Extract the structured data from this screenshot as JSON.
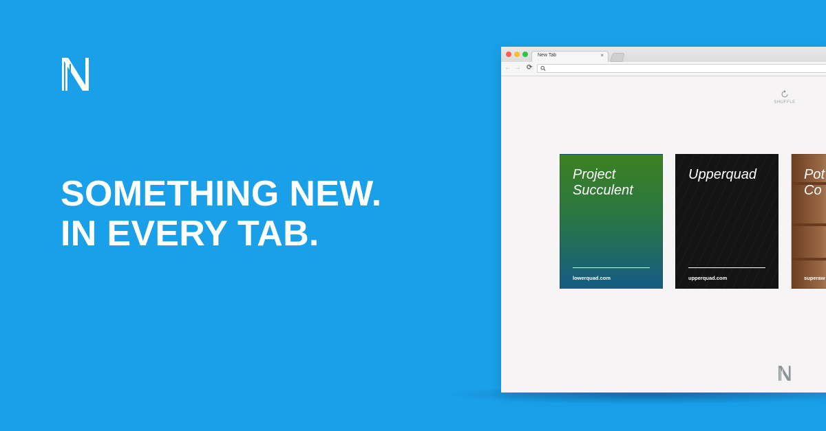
{
  "headline": {
    "line1": "SOMETHING NEW.",
    "line2": "IN EVERY TAB."
  },
  "colors": {
    "background": "#19a0e8",
    "browser_page": "#f6f4f4",
    "text_on_blue": "#ffffff"
  },
  "browser": {
    "tab_title": "New Tab",
    "tab_close": "×",
    "nav": {
      "back": "←",
      "forward": "→",
      "reload": "⟳"
    }
  },
  "shuffle": {
    "label": "SHUFFLE",
    "icon": "refresh-icon"
  },
  "cards": [
    {
      "title_line1": "Project",
      "title_line2": "Succulent",
      "domain": "lowerquad.com"
    },
    {
      "title_line1": "Upperquad",
      "title_line2": "",
      "domain": "upperquad.com"
    },
    {
      "title_line1": "Pot",
      "title_line2": "Co",
      "domain": "superaw"
    }
  ],
  "icons": {
    "brand": "n-logo-icon",
    "search": "search-icon"
  }
}
